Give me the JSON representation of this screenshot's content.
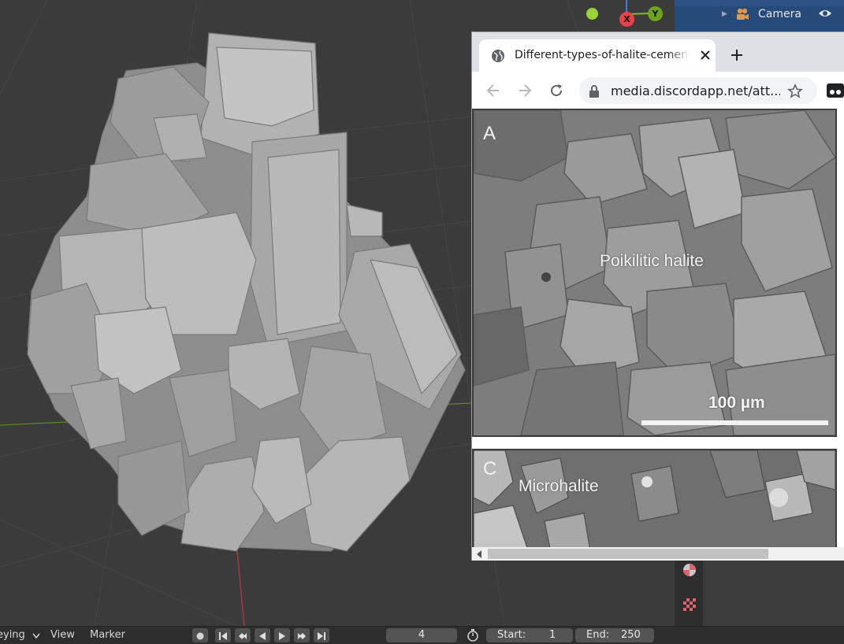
{
  "outliner": {
    "item_label": "Camera"
  },
  "gizmo": {
    "x_label": "X",
    "y_label": "Y"
  },
  "browser": {
    "tab_title": "Different-types-of-halite-cement",
    "url": "media.discordapp.net/att..."
  },
  "image": {
    "panel_a_letter": "A",
    "panel_a_caption": "Poikilitic halite",
    "scale_label": "100 µm",
    "panel_c_letter": "C",
    "panel_c_caption": "Microhalite"
  },
  "timeline": {
    "mode_label": "eying",
    "view_label": "View",
    "marker_label": "Marker",
    "current_frame": "4",
    "start_label": "Start:",
    "start_value": "1",
    "end_label": "End:",
    "end_value": "250"
  },
  "colors": {
    "viewport_bg": "#3b3b3b",
    "gizmo_x": "#e8404a",
    "gizmo_y": "#6ea31d",
    "outliner_selection": "#264a7a"
  }
}
